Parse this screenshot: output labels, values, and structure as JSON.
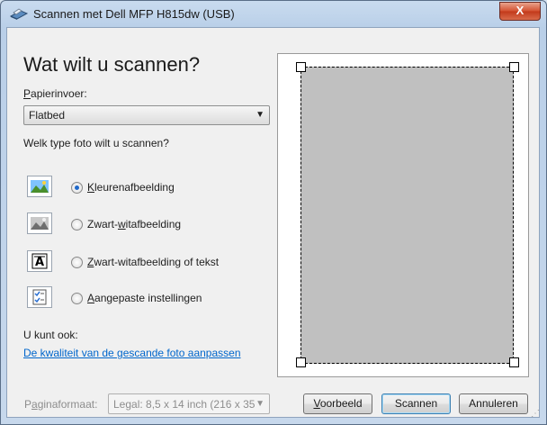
{
  "window": {
    "title": "Scannen met Dell MFP H815dw (USB)",
    "close_label": "X"
  },
  "main": {
    "heading": "Wat wilt u scannen?",
    "paper_source": {
      "label": "Papierinvoer:",
      "access_key": "P",
      "label_rest": "apierinvoer:",
      "value": "Flatbed"
    },
    "photo_type_prompt": "Welk type foto wilt u scannen?",
    "options": [
      {
        "pre": "",
        "key": "K",
        "post": "leurenafbeelding",
        "icon": "color-picture-icon",
        "selected": true
      },
      {
        "pre": "Zwart-",
        "key": "w",
        "post": "itafbeelding",
        "icon": "grayscale-picture-icon",
        "selected": false
      },
      {
        "pre": "",
        "key": "Z",
        "post": "wart-witafbeelding of tekst",
        "icon": "bw-text-icon",
        "selected": false
      },
      {
        "pre": "",
        "key": "A",
        "post": "angepaste instellingen",
        "icon": "custom-settings-icon",
        "selected": false
      }
    ],
    "also_label": "U kunt ook:",
    "quality_link": "De kwaliteit van de gescande foto aanpassen"
  },
  "footer": {
    "paper_size_label_pre": "P",
    "paper_size_label_key": "a",
    "paper_size_label_post": "ginaformaat:",
    "paper_size_value": "Legal: 8,5 x 14 inch (216 x 35",
    "preview_button": {
      "key": "V",
      "rest": "oorbeeld"
    },
    "scan_button": "Scannen",
    "cancel_button": "Annuleren"
  },
  "colors": {
    "link": "#0066cc",
    "preview_page": "#c0c0c0",
    "selected_radio": "#1f68c9"
  }
}
